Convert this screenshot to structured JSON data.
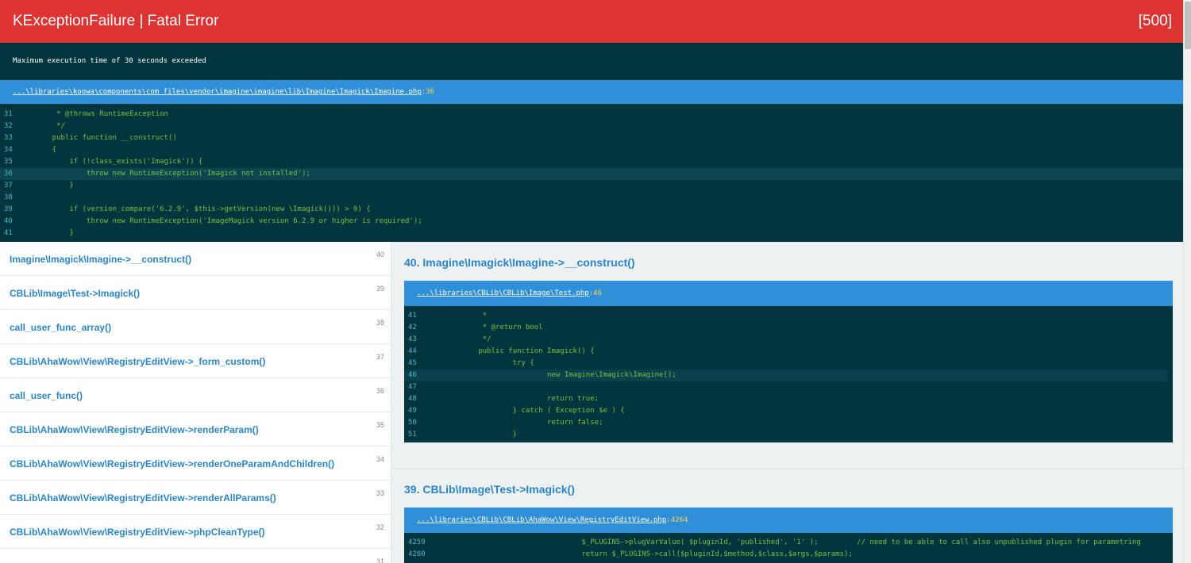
{
  "header": {
    "title": "KExceptionFailure | Fatal Error",
    "code": "[500]"
  },
  "message": "Maximum execution time of 30 seconds exceeded",
  "top_file": {
    "path": "...\\libraries\\koowa\\components\\com_files\\vendor\\imagine\\imagine\\lib\\Imagine\\Imagick\\Imagine.php",
    "line": ":36"
  },
  "top_code": [
    {
      "ln": "31",
      "src": "     * @throws RuntimeException"
    },
    {
      "ln": "32",
      "src": "     */"
    },
    {
      "ln": "33",
      "src": "    public function __construct()"
    },
    {
      "ln": "34",
      "src": "    {"
    },
    {
      "ln": "35",
      "src": "        if (!class_exists('Imagick')) {"
    },
    {
      "ln": "36",
      "src": "            throw new RuntimeException('Imagick not installed');"
    },
    {
      "ln": "37",
      "src": "        }"
    },
    {
      "ln": "38",
      "src": ""
    },
    {
      "ln": "39",
      "src": "        if (version_compare('6.2.9', $this->getVersion(new \\Imagick())) > 0) {"
    },
    {
      "ln": "40",
      "src": "            throw new RuntimeException('ImageMagick version 6.2.9 or higher is required');"
    },
    {
      "ln": "41",
      "src": "        }"
    }
  ],
  "trace": [
    {
      "fn": "Imagine\\Imagick\\Imagine->__construct()",
      "num": "40"
    },
    {
      "fn": "CBLib\\Image\\Test->Imagick()",
      "num": "39"
    },
    {
      "fn": "call_user_func_array()",
      "num": "38"
    },
    {
      "fn": "CBLib\\AhaWow\\View\\RegistryEditView->_form_custom()",
      "num": "37"
    },
    {
      "fn": "call_user_func()",
      "num": "36"
    },
    {
      "fn": "CBLib\\AhaWow\\View\\RegistryEditView->renderParam()",
      "num": "35"
    },
    {
      "fn": "CBLib\\AhaWow\\View\\RegistryEditView->renderOneParamAndChildren()",
      "num": "34"
    },
    {
      "fn": "CBLib\\AhaWow\\View\\RegistryEditView->renderAllParams()",
      "num": "33"
    },
    {
      "fn": "CBLib\\AhaWow\\View\\RegistryEditView->phpCleanType()",
      "num": "32"
    },
    {
      "fn": "",
      "num": "31"
    }
  ],
  "frames": [
    {
      "title": "40. Imagine\\Imagick\\Imagine->__construct()",
      "path": "...\\libraries\\CBLib\\CBLib\\Image\\Test.php",
      "line": ":46",
      "code": [
        {
          "ln": "41",
          "src": "         *"
        },
        {
          "ln": "42",
          "src": "         * @return bool"
        },
        {
          "ln": "43",
          "src": "         */"
        },
        {
          "ln": "44",
          "src": "        public function Imagick() {"
        },
        {
          "ln": "45",
          "src": "                try {"
        },
        {
          "ln": "46",
          "src": "                        new Imagine\\Imagick\\Imagine();"
        },
        {
          "ln": "47",
          "src": ""
        },
        {
          "ln": "48",
          "src": "                        return true;"
        },
        {
          "ln": "49",
          "src": "                } catch ( Exception $e ) {"
        },
        {
          "ln": "50",
          "src": "                        return false;"
        },
        {
          "ln": "51",
          "src": "                }"
        }
      ]
    },
    {
      "title": "39. CBLib\\Image\\Test->Imagick()",
      "path": "...\\libraries\\CBLib\\CBLib\\AhaWow\\View\\RegistryEditView.php",
      "line": ":4264",
      "code": [
        {
          "ln": "4259",
          "src": "                                $_PLUGINS->plugVarValue( $pluginId, 'published', '1' );         // need to be able to call also unpublished plugin for parametring"
        },
        {
          "ln": "4260",
          "src": "                                return $_PLUGINS->call($pluginId,$method,$class,$args,$params);"
        }
      ]
    }
  ]
}
